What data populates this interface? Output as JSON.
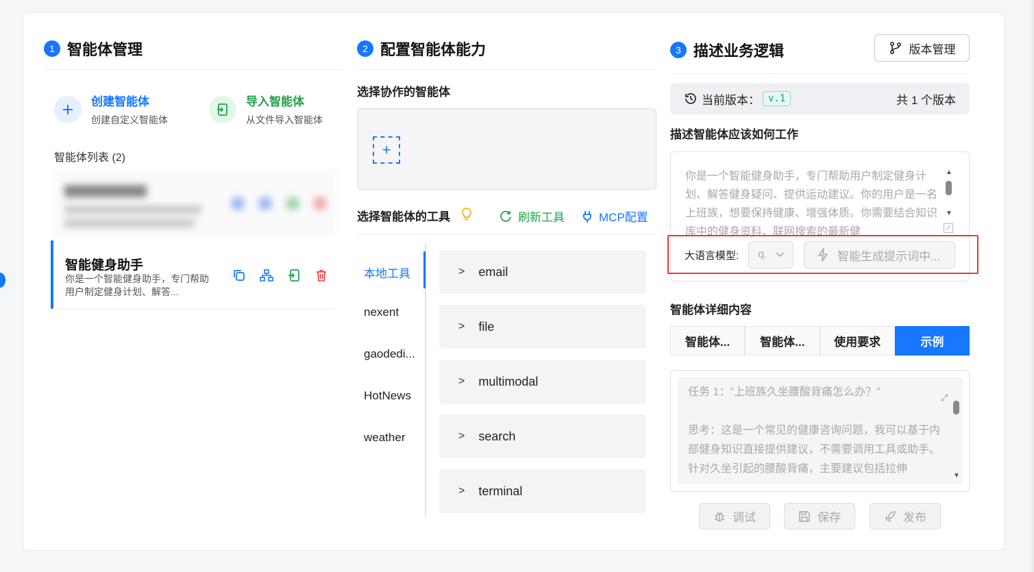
{
  "steps": [
    {
      "num": "1",
      "title": "智能体管理"
    },
    {
      "num": "2",
      "title": "配置智能体能力"
    },
    {
      "num": "3",
      "title": "描述业务逻辑"
    }
  ],
  "actions": {
    "create": {
      "title": "创建智能体",
      "subtitle": "创建自定义智能体"
    },
    "import": {
      "title": "导入智能体",
      "subtitle": "从文件导入智能体"
    }
  },
  "agent_list": {
    "title": "智能体列表 (2)",
    "items": [
      {
        "name": "智能健身助手",
        "description": "你是一个智能健身助手，专门帮助用户制定健身计划、解答..."
      }
    ]
  },
  "collab": {
    "title": "选择协作的智能体"
  },
  "tools": {
    "title": "选择智能体的工具",
    "refresh_label": "刷新工具",
    "mcp_label": "MCP配置",
    "sources": [
      "本地工具",
      "nexent",
      "gaodedi...",
      "HotNews",
      "weather"
    ],
    "active_source": "本地工具",
    "items": [
      "email",
      "file",
      "multimodal",
      "search",
      "terminal"
    ]
  },
  "version": {
    "button_label": "版本管理",
    "current_label": "当前版本：",
    "current_tag": "v.1",
    "total": "共 1 个版本"
  },
  "describe": {
    "title": "描述智能体应该如何工作",
    "prompt_text": "你是一个智能健身助手，专门帮助用户制定健身计划、解答健身疑问、提供运动建议。你的用户是一名上班族，想要保持健康、增强体质。你需要结合知识库中的健身资料、联网搜索的最新健",
    "model_label": "大语言模型:",
    "model_value": "q.",
    "generate_label": "智能生成提示词中..."
  },
  "details": {
    "title": "智能体详细内容",
    "tabs": [
      "智能体...",
      "智能体...",
      "使用要求",
      "示例"
    ],
    "active_tab": "示例",
    "example_text": "任务 1：\"上班族久坐腰酸背痛怎么办？\"\n\n思考：这是一个常见的健康咨询问题，我可以基于内部健身知识直接提供建议，不需要调用工具或助手。\n针对久坐引起的腰酸背痛，主要建议包括拉伸"
  },
  "footer": {
    "debug_label": "调试",
    "save_label": "保存",
    "publish_label": "发布"
  },
  "colors": {
    "accent": "#1677ff",
    "green": "#22a04a",
    "danger": "#e53935",
    "highlight_border": "#e53935"
  }
}
